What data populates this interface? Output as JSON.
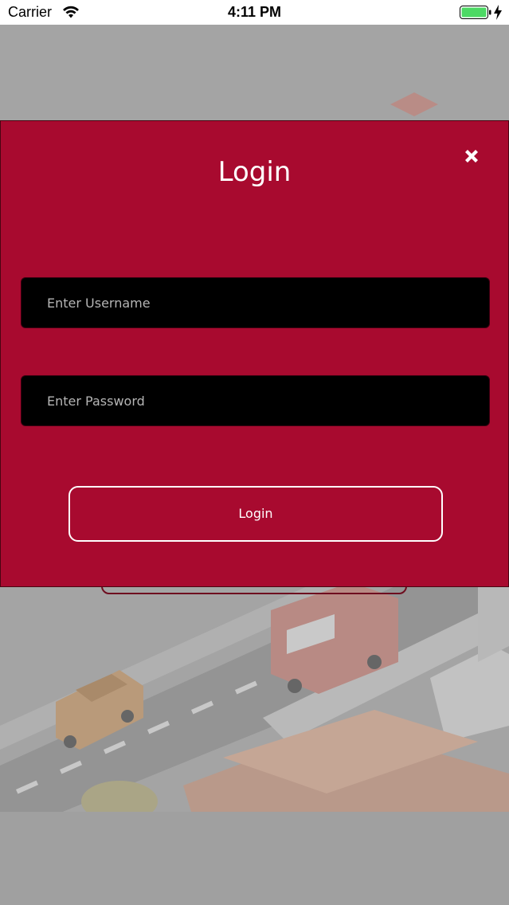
{
  "status_bar": {
    "carrier": "Carrier",
    "time": "4:11 PM",
    "battery_color": "#4cd964"
  },
  "modal": {
    "title": "Login",
    "username_placeholder": "Enter Username",
    "password_placeholder": "Enter Password",
    "login_label": "Login",
    "background_color": "#a80a2f"
  },
  "icons": {
    "close": "close-icon",
    "wifi": "wifi-icon",
    "battery": "battery-icon",
    "charging": "charging-icon"
  }
}
